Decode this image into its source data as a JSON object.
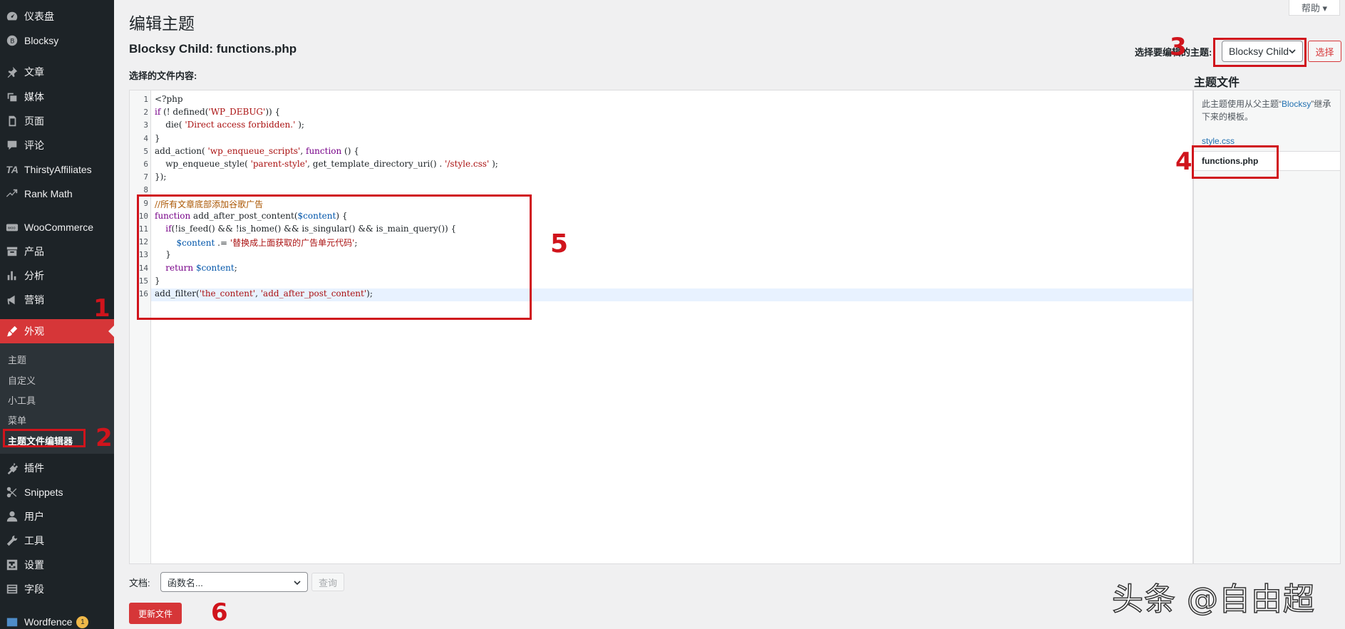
{
  "sidebar": {
    "items": [
      {
        "label": "仪表盘",
        "icon": "dashboard-icon"
      },
      {
        "label": "Blocksy",
        "icon": "blocksy-icon"
      },
      {
        "label": "文章",
        "icon": "pin-icon"
      },
      {
        "label": "媒体",
        "icon": "media-icon"
      },
      {
        "label": "页面",
        "icon": "page-icon"
      },
      {
        "label": "评论",
        "icon": "comment-icon"
      },
      {
        "label": "ThirstyAffiliates",
        "icon": "ta-icon"
      },
      {
        "label": "Rank Math",
        "icon": "rank-math-icon"
      },
      {
        "label": "WooCommerce",
        "icon": "woo-icon"
      },
      {
        "label": "产品",
        "icon": "archive-icon"
      },
      {
        "label": "分析",
        "icon": "chart-icon"
      },
      {
        "label": "营销",
        "icon": "megaphone-icon"
      },
      {
        "label": "外观",
        "icon": "brush-icon"
      },
      {
        "label": "插件",
        "icon": "plugin-icon"
      },
      {
        "label": "Snippets",
        "icon": "snippets-icon"
      },
      {
        "label": "用户",
        "icon": "user-icon"
      },
      {
        "label": "工具",
        "icon": "wrench-icon"
      },
      {
        "label": "设置",
        "icon": "settings-icon"
      },
      {
        "label": "字段",
        "icon": "fields-icon"
      },
      {
        "label": "Wordfence",
        "icon": "wordfence-icon",
        "badge": "1"
      }
    ],
    "submenu": [
      "主题",
      "自定义",
      "小工具",
      "菜单",
      "主题文件编辑器"
    ]
  },
  "header": {
    "page_title": "编辑主题",
    "file_title": "Blocksy Child: functions.php",
    "content_label": "选择的文件内容:",
    "help": "帮助 ▾"
  },
  "theme_select": {
    "label": "选择要编辑的主题:",
    "value": "Blocksy Child",
    "button": "选择"
  },
  "editor": {
    "line_numbers": [
      "1",
      "2",
      "3",
      "4",
      "5",
      "6",
      "7",
      "8",
      "9",
      "10",
      "11",
      "12",
      "13",
      "14",
      "15",
      "16"
    ],
    "lines": [
      "<?php",
      "if (! defined('WP_DEBUG')) {",
      "    die( 'Direct access forbidden.' );",
      "}",
      "add_action( 'wp_enqueue_scripts', function () {",
      "    wp_enqueue_style( 'parent-style', get_template_directory_uri() . '/style.css' );",
      "});",
      "",
      "//所有文章底部添加谷歌广告",
      "function add_after_post_content($content) {",
      "    if(!is_feed() && !is_home() && is_singular() && is_main_query()) {",
      "        $content .= '替换成上面获取的广告单元代码';",
      "    }",
      "    return $content;",
      "}",
      "add_filter('the_content', 'add_after_post_content');"
    ]
  },
  "theme_files": {
    "title": "主题文件",
    "note_prefix": "此主题使用从父主题“",
    "note_parent": "Blocksy",
    "note_suffix": "”继承下来的模板。",
    "files": [
      "style.css",
      "functions.php"
    ]
  },
  "bottom": {
    "doc_label": "文档:",
    "func_placeholder": "函数名...",
    "lookup": "查询",
    "update": "更新文件"
  },
  "annotations": [
    "1",
    "2",
    "3",
    "4",
    "5",
    "6"
  ],
  "watermark": "头条 @自由超",
  "colors": {
    "sidebar_bg": "#1d2327",
    "accent_red": "#d63638",
    "annotation_red": "#d0141c",
    "link_blue": "#2271b1"
  }
}
